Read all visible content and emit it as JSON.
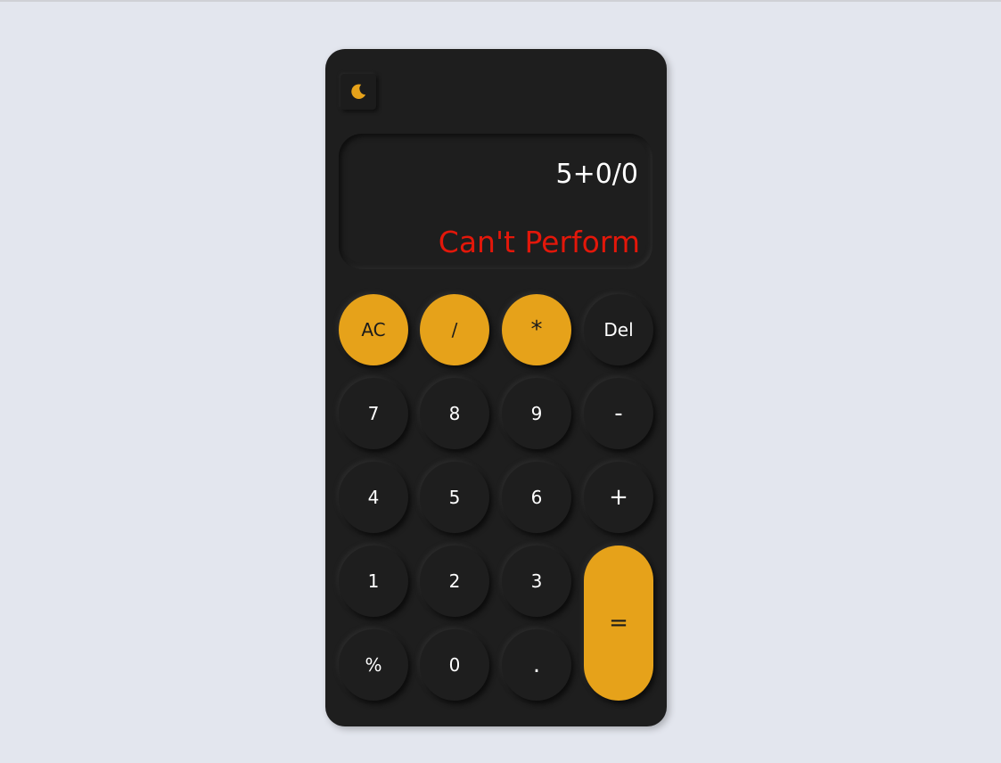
{
  "colors": {
    "page_background": "#e3e6ee",
    "calculator_body": "#1e1e1e",
    "accent": "#e6a21a",
    "error_text": "#e3170a",
    "key_text": "#ffffff"
  },
  "theme_toggle": {
    "icon": "moon-icon"
  },
  "display": {
    "expression": "5+0/0",
    "result": "Can't Perform"
  },
  "keys": {
    "ac": "AC",
    "divide": "/",
    "multiply": "*",
    "del": "Del",
    "seven": "7",
    "eight": "8",
    "nine": "9",
    "minus": "-",
    "four": "4",
    "five": "5",
    "six": "6",
    "plus": "+",
    "one": "1",
    "two": "2",
    "three": "3",
    "equals": "=",
    "percent": "%",
    "zero": "0",
    "dot": "."
  }
}
